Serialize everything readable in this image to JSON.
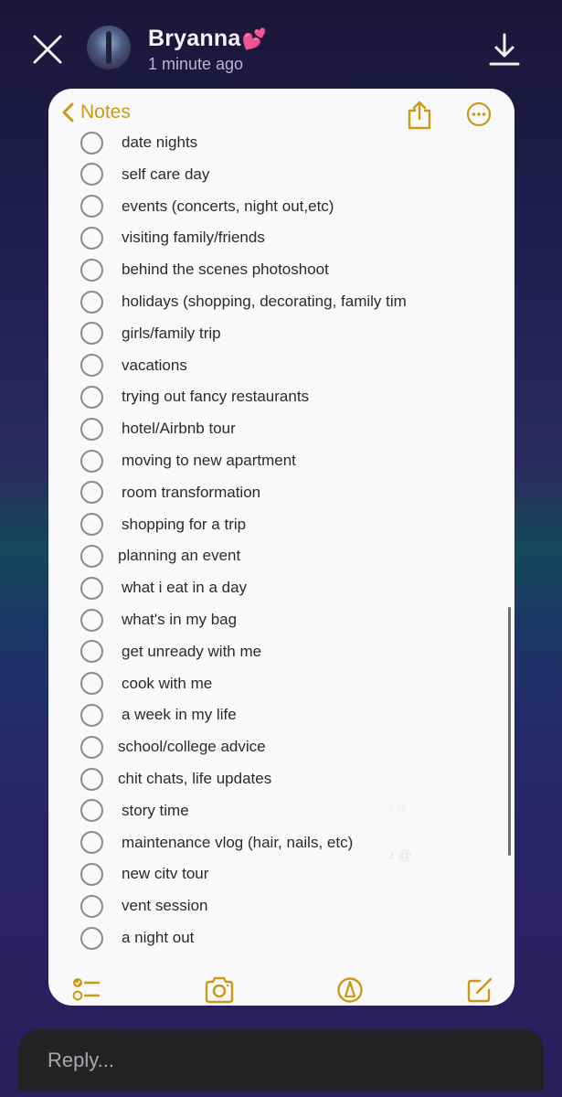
{
  "story": {
    "user_name": "Bryanna",
    "user_emoji": "💕",
    "timestamp": "1 minute ago"
  },
  "notes": {
    "back_label": "Notes",
    "accent_color": "#c99a14",
    "items": [
      "date nights",
      "self care day",
      "events (concerts, night out,etc)",
      "visiting family/friends",
      "behind the scenes photoshoot",
      "holidays (shopping, decorating, family tim",
      "girls/family trip",
      "vacations",
      "trying out fancy restaurants",
      "hotel/Airbnb tour",
      "moving to new apartment",
      "room transformation",
      "shopping for a trip",
      "planning an event",
      "what i eat in a day",
      "what's in my bag",
      "get unready with me",
      "cook with me",
      "a week in my life",
      "school/college advice",
      "chit chats, life updates",
      "story time",
      "maintenance vlog (hair, nails, etc)",
      "new citv tour",
      "vent session",
      "a night out"
    ],
    "toolbar": [
      "checklist",
      "camera",
      "markup",
      "compose"
    ]
  },
  "watermark": "♪ @",
  "reply": {
    "placeholder": "Reply..."
  }
}
